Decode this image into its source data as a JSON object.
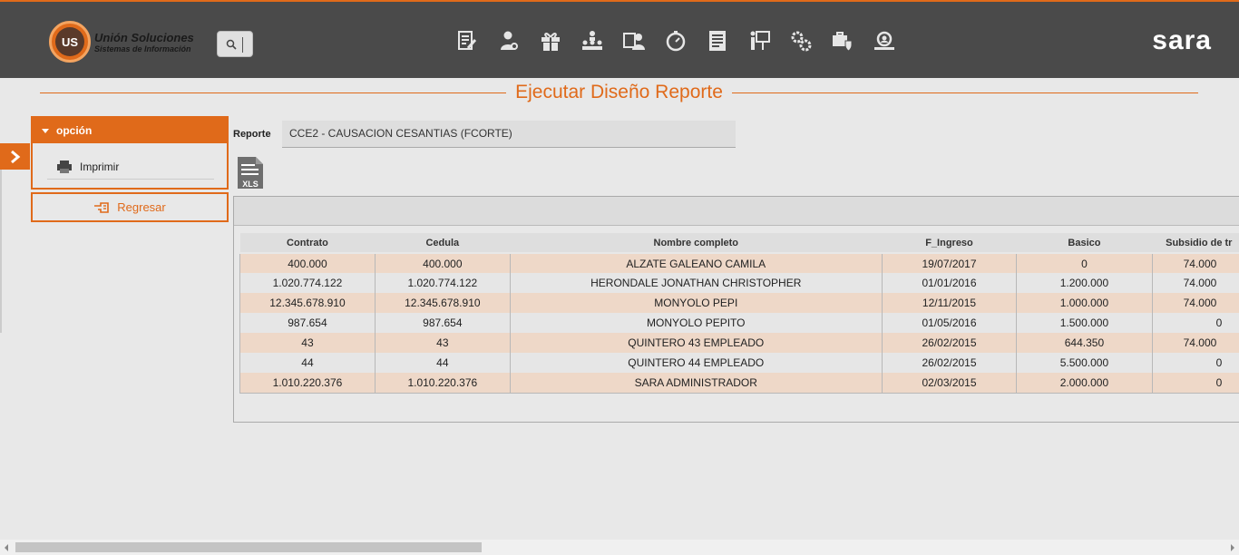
{
  "header": {
    "logo_badge": "US",
    "logo_title": "Unión Soluciones",
    "logo_subtitle": "Sistemas de Información",
    "brand": "sara",
    "nav_icons": [
      "document-edit-icon",
      "user-settings-icon",
      "gift-icon",
      "hierarchy-icon",
      "employee-card-icon",
      "stopwatch-icon",
      "report-list-icon",
      "presentation-icon",
      "gears-icon",
      "medical-shield-icon",
      "search-user-icon"
    ]
  },
  "page": {
    "title": "Ejecutar Diseño Reporte"
  },
  "sidebar": {
    "panel_title": "opción",
    "print_label": "Imprimir",
    "back_label": "Regresar"
  },
  "report": {
    "label": "Reporte",
    "value": "CCE2 - CAUSACION CESANTIAS (FCORTE)",
    "export_label": "XLS"
  },
  "grid": {
    "columns": [
      "Contrato",
      "Cedula",
      "Nombre completo",
      "F_Ingreso",
      "Basico",
      "Subsidio de tr"
    ],
    "rows": [
      [
        "400.000",
        "400.000",
        "ALZATE GALEANO CAMILA",
        "19/07/2017",
        "0",
        "74.000"
      ],
      [
        "1.020.774.122",
        "1.020.774.122",
        "HERONDALE JONATHAN CHRISTOPHER",
        "01/01/2016",
        "1.200.000",
        "74.000"
      ],
      [
        "12.345.678.910",
        "12.345.678.910",
        "MONYOLO PEPI",
        "12/11/2015",
        "1.000.000",
        "74.000"
      ],
      [
        "987.654",
        "987.654",
        "MONYOLO PEPITO",
        "01/05/2016",
        "1.500.000",
        "0"
      ],
      [
        "43",
        "43",
        "QUINTERO 43 EMPLEADO",
        "26/02/2015",
        "644.350",
        "74.000"
      ],
      [
        "44",
        "44",
        "QUINTERO 44 EMPLEADO",
        "26/02/2015",
        "5.500.000",
        "0"
      ],
      [
        "1.010.220.376",
        "1.010.220.376",
        "SARA ADMINISTRADOR",
        "02/03/2015",
        "2.000.000",
        "0"
      ]
    ]
  },
  "colors": {
    "accent": "#e06a1a",
    "topbar": "#4a4a4a",
    "row_highlight": "#eed8c8"
  }
}
